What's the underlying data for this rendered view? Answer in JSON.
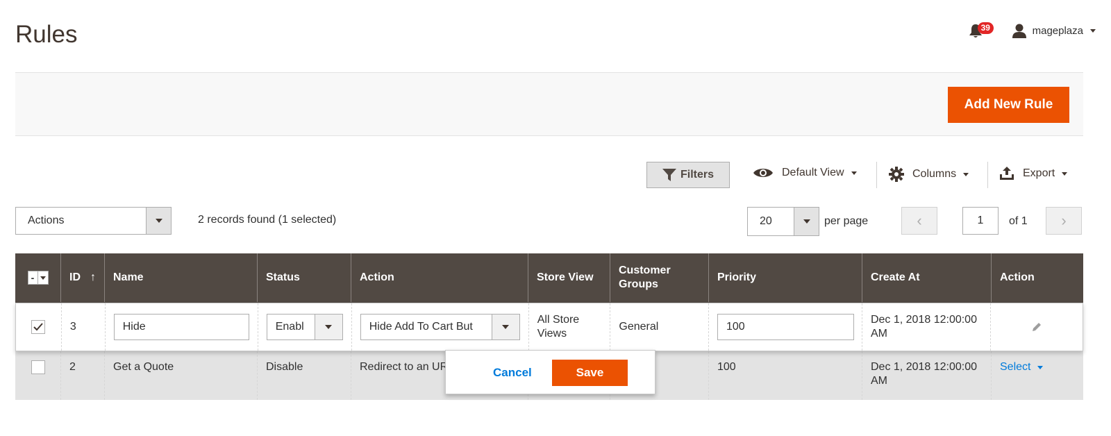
{
  "page": {
    "title": "Rules"
  },
  "header": {
    "notification_count": "39",
    "username": "mageplaza"
  },
  "action_bar": {
    "add_button": "Add New Rule"
  },
  "toolbar": {
    "filters": "Filters",
    "view": "Default View",
    "columns": "Columns",
    "export": "Export"
  },
  "grid_controls": {
    "actions": "Actions",
    "records_found": "2 records found (1 selected)",
    "per_page_value": "20",
    "per_page_label": "per page",
    "page_value": "1",
    "page_of": "of 1"
  },
  "columns": {
    "mass_select": "-",
    "id": "ID",
    "id_sort": "↑",
    "name": "Name",
    "status": "Status",
    "action": "Action",
    "store_view": "Store View",
    "customer_groups": "Customer Groups",
    "priority": "Priority",
    "create_at": "Create At",
    "row_action": "Action"
  },
  "rows": [
    {
      "checked": true,
      "id": "3",
      "name": "Hide",
      "status": "Enabl",
      "action": "Hide Add To Cart But",
      "store_view": "All Store Views",
      "customer_groups": "General",
      "priority": "100",
      "create_at": "Dec 1, 2018 12:00:00 AM",
      "editing": true
    },
    {
      "checked": false,
      "id": "2",
      "name": "Get a Quote",
      "status": "Disable",
      "action": "Redirect to an UR",
      "store_view": "",
      "customer_groups": "",
      "priority": "100",
      "create_at": "Dec 1, 2018 12:00:00 AM",
      "row_action": "Select"
    }
  ],
  "edit_popup": {
    "cancel": "Cancel",
    "save": "Save"
  },
  "colors": {
    "accent": "#eb5202",
    "header_bg": "#514943",
    "link": "#007bdb"
  }
}
